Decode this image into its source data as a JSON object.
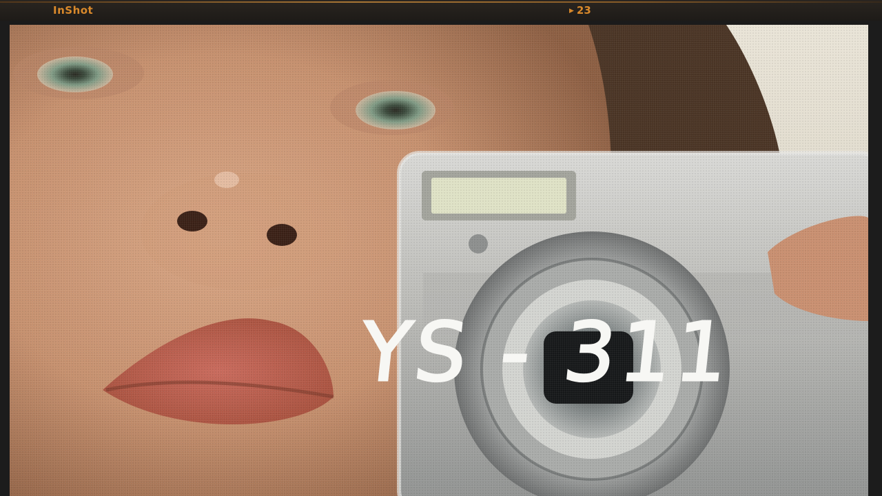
{
  "film": {
    "brand": "InShot",
    "frame_number": "23"
  },
  "overlay": {
    "handwritten_text": "YS - 311"
  },
  "colors": {
    "film_text": "#d9892b",
    "frame_border": "#1c1c1c"
  },
  "icons": {
    "frame_marker": "triangle-right-icon"
  }
}
